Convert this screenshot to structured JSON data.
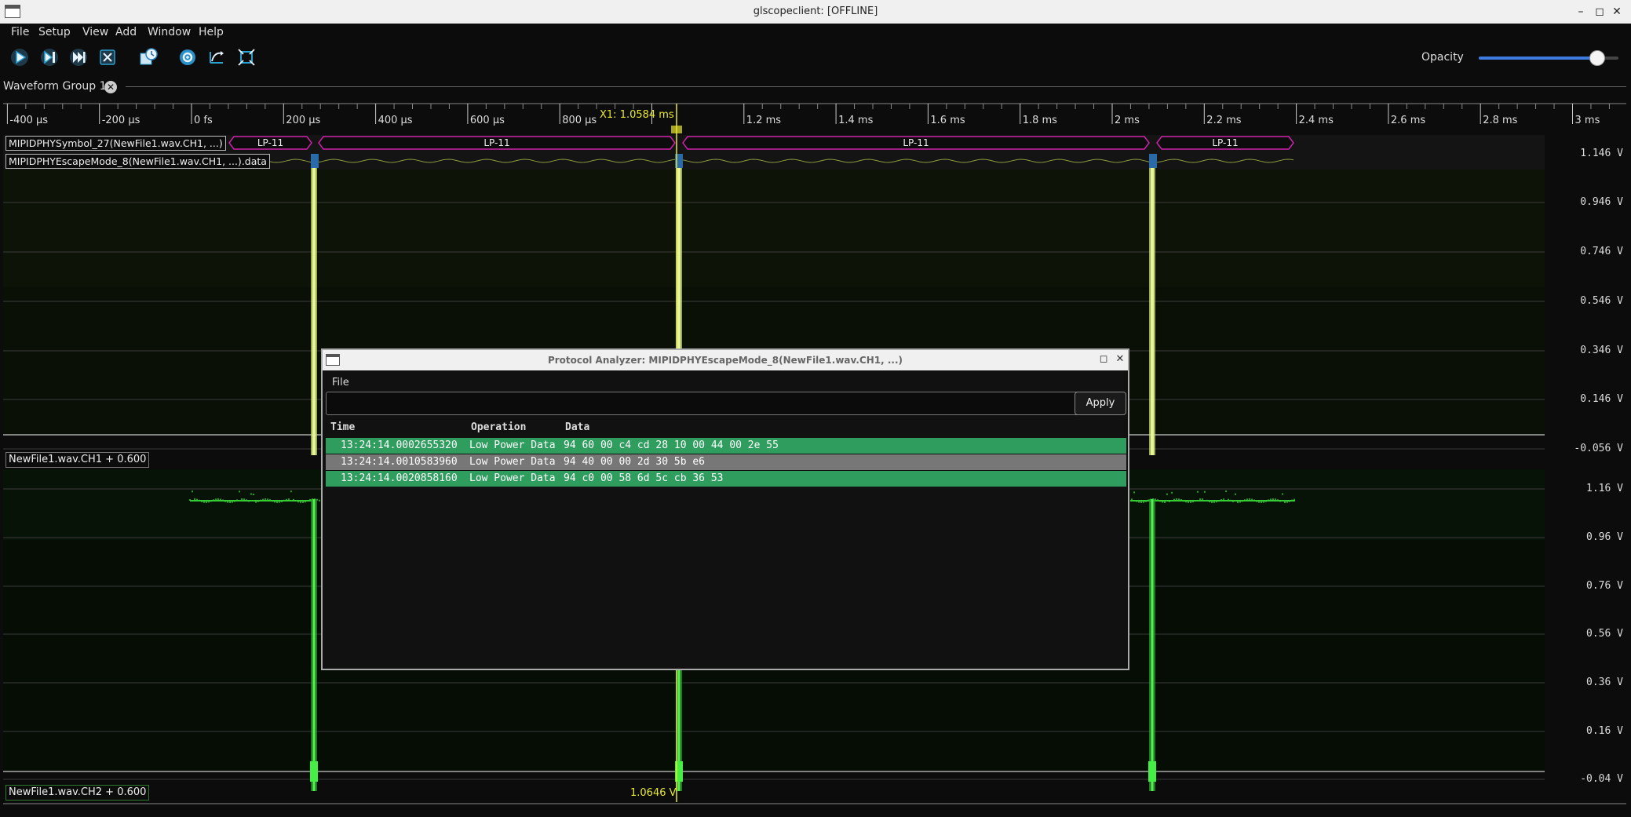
{
  "window": {
    "title": "glscopeclient: [OFFLINE]"
  },
  "menu": [
    "File",
    "Setup",
    "View",
    "Add",
    "Window",
    "Help"
  ],
  "toolbar": {
    "buttons": [
      "play-icon",
      "play-single-icon",
      "forced-trigger-icon",
      "stop-icon",
      "history-icon",
      "refresh-icon",
      "fullscreen-icon",
      "zoom-fit-icon"
    ],
    "opacity_label": "Opacity",
    "opacity_value": 0.85
  },
  "group_tab": {
    "label": "Waveform Group 1"
  },
  "timeline": {
    "ticks": [
      "-400 µs",
      "-200 µs",
      "0 fs",
      "200 µs",
      "400 µs",
      "600 µs",
      "800 µs",
      "1.2 ms",
      "1.4 ms",
      "1.6 ms",
      "1.8 ms",
      "2 ms",
      "2.2 ms",
      "2.4 ms",
      "2.6 ms",
      "2.8 ms",
      "3 ms"
    ],
    "cursor_label": "X1: 1.0584 ms"
  },
  "protocol_rows": {
    "symbol_label": "MIPIDPHYSymbol_27(NewFile1.wav.CH1, ...)",
    "escape_label": "MIPIDPHYEscapeMode_8(NewFile1.wav.CH1, ...).data",
    "symbols": [
      "LP-11",
      "LP-11",
      "LP-11",
      "LP-11"
    ]
  },
  "channels": [
    {
      "label": "NewFile1.wav.CH1 + 0.600",
      "scale": [
        "1.146 V",
        "0.946 V",
        "0.746 V",
        "0.546 V",
        "0.346 V",
        "0.146 V",
        "-0.056 V"
      ]
    },
    {
      "label": "NewFile1.wav.CH2 + 0.600",
      "scale": [
        "1.16 V",
        "0.96 V",
        "0.76 V",
        "0.56 V",
        "0.36 V",
        "0.16 V",
        "-0.04 V"
      ]
    }
  ],
  "cursor_readout": "1.0646 V",
  "colors": {
    "cursor": "#e8e82e",
    "trace1": "#c9e070",
    "trace2": "#33cc33",
    "protocol": "#cc22aa",
    "row_green": "#2e9d5e",
    "row_gray": "#777777"
  },
  "analyzer": {
    "title": "Protocol Analyzer: MIPIDPHYEscapeMode_8(NewFile1.wav.CH1, ...)",
    "menu": "File",
    "filter_value": "",
    "apply_label": "Apply",
    "columns": [
      "Time",
      "Operation",
      "Data"
    ],
    "rows": [
      {
        "time": "13:24:14.0002655320",
        "op": "Low Power Data",
        "data": "94 60 00 c4 cd 28 10 00 44 00 2e 55",
        "style": "green"
      },
      {
        "time": "13:24:14.0010583960",
        "op": "Low Power Data",
        "data": "94 40 00 00 2d 30 5b e6",
        "style": "gray"
      },
      {
        "time": "13:24:14.0020858160",
        "op": "Low Power Data",
        "data": "94 c0 00 58 6d 5c cb 36 53",
        "style": "green"
      }
    ]
  }
}
